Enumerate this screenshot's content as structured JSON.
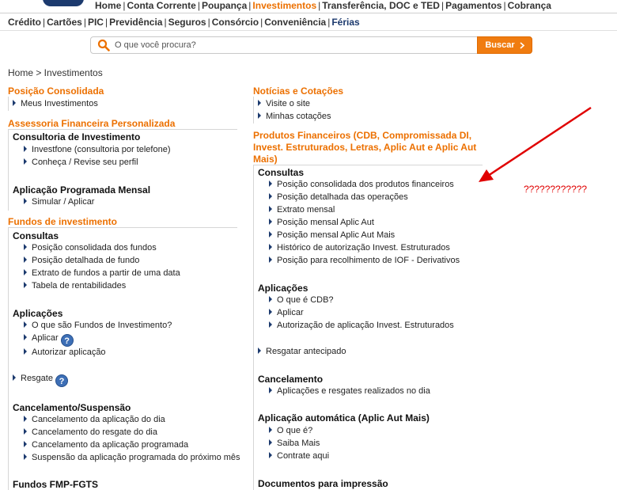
{
  "top_nav": {
    "items": [
      "Home",
      "Conta Corrente",
      "Poupança",
      "Investimentos",
      "Transferência, DOC e TED",
      "Pagamentos",
      "Cobrança"
    ]
  },
  "sub_nav": {
    "items": [
      "Crédito",
      "Cartões",
      "PIC",
      "Previdência",
      "Seguros",
      "Consórcio",
      "Conveniência",
      "Férias"
    ]
  },
  "search": {
    "placeholder": "O que você procura?",
    "button": "Buscar"
  },
  "breadcrumb": "Home > Investimentos",
  "left": {
    "posicao_title": "Posição Consolidada",
    "posicao_links": [
      "Meus Investimentos"
    ],
    "assessoria_title": "Assessoria Financeira Personalizada",
    "consultoria_title": "Consultoria de Investimento",
    "consultoria_links": [
      "Investfone (consultoria por telefone)",
      "Conheça / Revise seu perfil"
    ],
    "aplicacao_prog_title": "Aplicação Programada Mensal",
    "aplicacao_prog_links": [
      "Simular / Aplicar"
    ],
    "fundos_title": "Fundos de investimento",
    "consultas_title": "Consultas",
    "consultas_links": [
      "Posição consolidada dos fundos",
      "Posição detalhada de fundo",
      "Extrato de fundos a partir de uma data",
      "Tabela de rentabilidades"
    ],
    "aplicacoes_title": "Aplicações",
    "aplicacoes_links": [
      "O que são Fundos de Investimento?",
      "Aplicar",
      "Autorizar aplicação"
    ],
    "resgate": "Resgate",
    "cancelamento_title": "Cancelamento/Suspensão",
    "cancelamento_links": [
      "Cancelamento da aplicação do dia",
      "Cancelamento do resgate do dia",
      "Cancelamento da aplicação programada",
      "Suspensão da aplicação programada do próximo mês"
    ],
    "fmp_title": "Fundos FMP-FGTS"
  },
  "right": {
    "noticias_title": "Notícias e Cotações",
    "noticias_links": [
      "Visite o site",
      "Minhas cotações"
    ],
    "produtos_title_lines": [
      "Produtos Financeiros (CDB, Compromissada DI,",
      "Invest. Estruturados, Letras, Aplic Aut e Aplic Aut",
      "Mais)"
    ],
    "consultas_title": "Consultas",
    "consultas_links": [
      "Posição consolidada dos produtos financeiros",
      "Posição detalhada das operações",
      "Extrato mensal",
      "Posição mensal Aplic Aut",
      "Posição mensal Aplic Aut Mais",
      "Histórico de autorização Invest. Estruturados",
      "Posição para recolhimento de IOF - Derivativos"
    ],
    "aplicacoes_title": "Aplicações",
    "aplicacoes_links": [
      "O que é CDB?",
      "Aplicar",
      "Autorização de aplicação Invest. Estruturados"
    ],
    "resgatar": "Resgatar antecipado",
    "cancelamento_title": "Cancelamento",
    "cancelamento_links": [
      "Aplicações e resgates realizados no dia"
    ],
    "aplic_auto_title": "Aplicação automática (Aplic Aut Mais)",
    "aplic_auto_links": [
      "O que é?",
      "Saiba Mais",
      "Contrate aqui"
    ],
    "documentos_title": "Documentos para impressão"
  },
  "annotation": {
    "text": "????????????",
    "color": "#e00000"
  },
  "help_icon_glyph": "?",
  "colors": {
    "accent": "#ec7000",
    "brand_blue": "#1c3a6e",
    "button": "#f07c10"
  }
}
